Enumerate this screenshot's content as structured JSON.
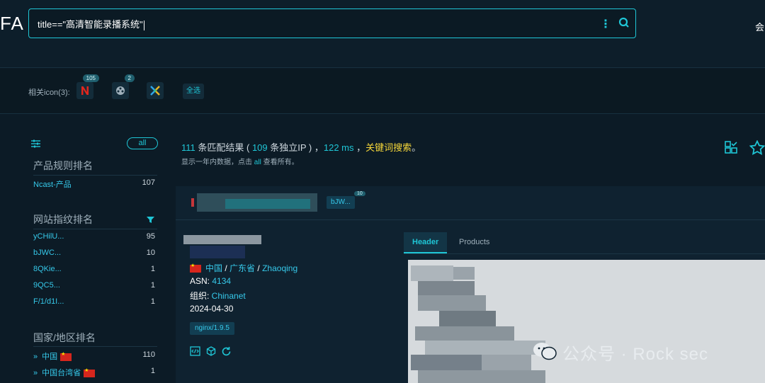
{
  "header": {
    "logo_text": "FA",
    "search_query": "title==\"高清智能录播系统\"",
    "top_right_text": "会"
  },
  "related_icons": {
    "label": "相关icon(3):",
    "items": [
      {
        "name": "n-logo",
        "badge": "105"
      },
      {
        "name": "reel-logo",
        "badge": "2"
      },
      {
        "name": "x-logo",
        "badge": ""
      }
    ],
    "select_all": "全选"
  },
  "sidebar": {
    "all_label": "all",
    "product_section": {
      "title": "产品规则排名",
      "items": [
        {
          "label": "Ncast-产品",
          "count": "107"
        }
      ]
    },
    "fingerprint_section": {
      "title": "网站指纹排名",
      "items": [
        {
          "label": "yCHilU...",
          "count": "95"
        },
        {
          "label": "bJWC...",
          "count": "10"
        },
        {
          "label": "8QKie...",
          "count": "1"
        },
        {
          "label": "9QC5...",
          "count": "1"
        },
        {
          "label": "F/1/d1I...",
          "count": "1"
        }
      ]
    },
    "country_section": {
      "title": "国家/地区排名",
      "items": [
        {
          "label": "中国",
          "count": "110"
        },
        {
          "label": "中国台湾省",
          "count": "1"
        }
      ]
    }
  },
  "summary": {
    "count": "111",
    "text1": " 条匹配结果 ( ",
    "ip_count": "109",
    "text2": " 条独立IP ) ，",
    "ms": "122 ms",
    "text3": " ，",
    "keyword": "关键词搜索",
    "end": "。",
    "sub_pre": "显示一年内数据，点击 ",
    "sub_all": "all",
    "sub_post": " 查看所有。"
  },
  "card": {
    "tag": "bJW...",
    "tag_badge": "10",
    "country": "中国",
    "sep1": "/",
    "province": "广东省",
    "sep2": "/",
    "city": "Zhaoqing",
    "asn_label": "ASN: ",
    "asn": "4134",
    "org_label": "组织: ",
    "org": "Chinanet",
    "date": "2024-04-30",
    "server_tag": "nginx/1.9.5",
    "tabs": {
      "active": "Header",
      "other": "Products"
    }
  },
  "watermark": "公众号 · Rock sec",
  "colors": {
    "accent": "#1fc6d6",
    "link": "#36c9ea",
    "keyword": "#f7d83a",
    "background": "#0c1b26"
  }
}
